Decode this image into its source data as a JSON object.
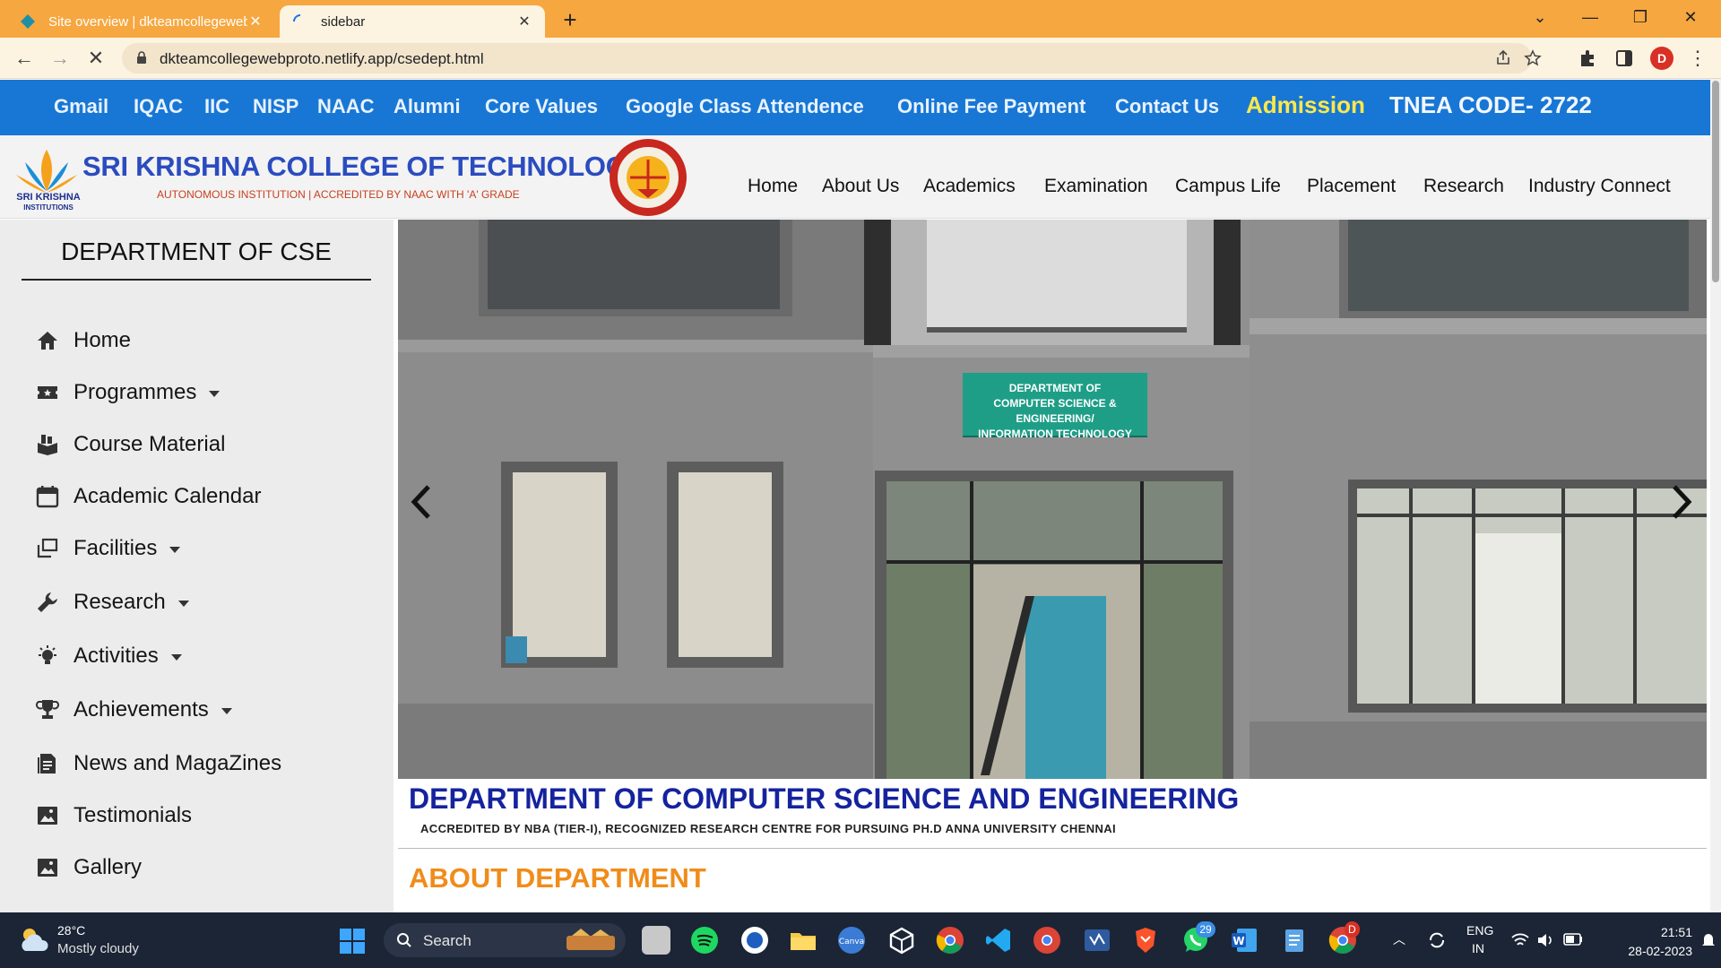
{
  "browser": {
    "tabs": [
      {
        "title": "Site overview | dkteamcollegeweb",
        "active": false
      },
      {
        "title": "sidebar",
        "active": true
      }
    ],
    "new_tab_label": "+",
    "url": "dkteamcollegewebproto.netlify.app/csedept.html",
    "profile_initial": "D",
    "accent_color": "#f6a73f"
  },
  "topbar": {
    "links": [
      "Gmail",
      "IQAC",
      "IIC",
      "NISP",
      "NAAC",
      "Alumni",
      "Core Values",
      "Google Class Attendence",
      "Online Fee Payment",
      "Contact Us"
    ],
    "admission": "Admission",
    "tnea": "TNEA CODE- 2722",
    "background": "#1877d4"
  },
  "header": {
    "logo_text": "SRI KRISHNA",
    "logo_text2": "INSTITUTIONS",
    "college_name": "SRI KRISHNA COLLEGE OF TECHNOLOGY",
    "college_sub": "AUTONOMOUS INSTITUTION | ACCREDITED BY NAAC WITH 'A' GRADE",
    "nav": [
      "Home",
      "About Us",
      "Academics",
      "Examination",
      "Campus Life",
      "Placement",
      "Research",
      "Industry Connect"
    ]
  },
  "sidebar": {
    "title": "DEPARTMENT OF CSE",
    "items": [
      {
        "label": "Home",
        "icon": "home-icon",
        "dropdown": false
      },
      {
        "label": "Programmes",
        "icon": "ticket-icon",
        "dropdown": true
      },
      {
        "label": "Course Material",
        "icon": "books-icon",
        "dropdown": false
      },
      {
        "label": "Academic Calendar",
        "icon": "calendar-icon",
        "dropdown": false
      },
      {
        "label": "Facilities",
        "icon": "copy-icon",
        "dropdown": true
      },
      {
        "label": "Research",
        "icon": "wrench-icon",
        "dropdown": true
      },
      {
        "label": "Activities",
        "icon": "bulb-icon",
        "dropdown": true
      },
      {
        "label": "Achievements",
        "icon": "trophy-icon",
        "dropdown": true
      },
      {
        "label": "News and MagaZines",
        "icon": "newspaper-icon",
        "dropdown": false
      },
      {
        "label": "Testimonials",
        "icon": "image-icon",
        "dropdown": false
      },
      {
        "label": "Gallery",
        "icon": "image-icon",
        "dropdown": false
      }
    ]
  },
  "hero": {
    "sign_line1": "DEPARTMENT OF",
    "sign_line2": "COMPUTER SCIENCE & ENGINEERING/",
    "sign_line3": "INFORMATION TECHNOLOGY"
  },
  "content": {
    "dept_title": "DEPARTMENT OF COMPUTER SCIENCE AND ENGINEERING",
    "dept_sub": "ACCREDITED BY NBA (TIER-I), RECOGNIZED RESEARCH CENTRE FOR PURSUING PH.D ANNA UNIVERSITY CHENNAI",
    "about_heading": "ABOUT DEPARTMENT"
  },
  "taskbar": {
    "temperature": "28°C",
    "weather": "Mostly cloudy",
    "search_label": "Search",
    "whatsapp_badge": "29",
    "chrome_badge": "D",
    "language": "ENG",
    "region": "IN",
    "time": "21:51",
    "date": "28-02-2023"
  }
}
